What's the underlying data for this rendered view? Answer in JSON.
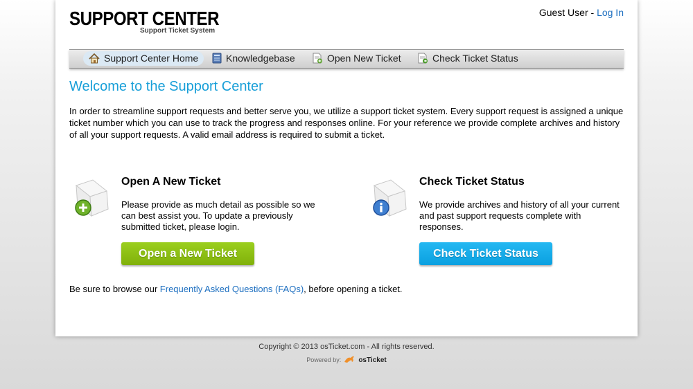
{
  "header": {
    "logo_title": "SUPPORT CENTER",
    "logo_subtitle": "Support Ticket System",
    "user_label": "Guest User - ",
    "login_link": "Log In"
  },
  "nav": {
    "items": [
      {
        "label": "Support Center Home",
        "icon": "home-icon"
      },
      {
        "label": "Knowledgebase",
        "icon": "book-icon"
      },
      {
        "label": "Open New Ticket",
        "icon": "new-ticket-icon"
      },
      {
        "label": "Check Ticket Status",
        "icon": "ticket-status-icon"
      }
    ]
  },
  "main": {
    "title": "Welcome to the Support Center",
    "intro": "In order to streamline support requests and better serve you, we utilize a support ticket system. Every support request is assigned a unique ticket number which you can use to track the progress and responses online. For your reference we provide complete archives and history of all your support requests. A valid email address is required to submit a ticket.",
    "open_panel": {
      "heading": "Open A New Ticket",
      "text": "Please provide as much detail as possible so we can best assist you. To update a previously submitted ticket, please login.",
      "button": "Open a New Ticket"
    },
    "check_panel": {
      "heading": "Check Ticket Status",
      "text": "We provide archives and history of all your current and past support requests complete with responses.",
      "button": "Check Ticket Status"
    },
    "faq_prefix": "Be sure to browse our ",
    "faq_link": "Frequently Asked Questions (FAQs)",
    "faq_suffix": ", before opening a ticket."
  },
  "footer": {
    "copyright": "Copyright © 2013 osTicket.com - All rights reserved.",
    "powered_label": "Powered by:",
    "brand": "osTicket"
  },
  "colors": {
    "accent_blue": "#189fd8",
    "link": "#1d6fc0",
    "green_button": "#8cc014",
    "blue_button": "#15aaea"
  }
}
